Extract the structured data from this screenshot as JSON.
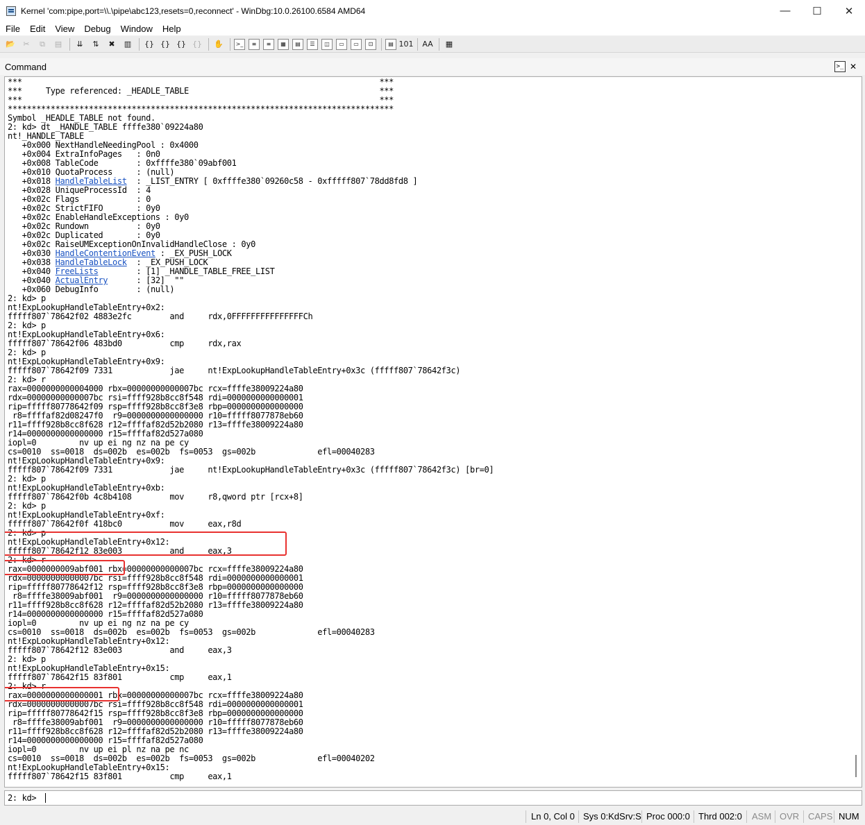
{
  "window": {
    "title": "Kernel 'com:pipe,port=\\\\.\\pipe\\abc123,resets=0,reconnect' - WinDbg:10.0.26100.6584 AMD64",
    "buttons": [
      "—",
      "☐",
      "✕"
    ]
  },
  "menu": [
    "File",
    "Edit",
    "View",
    "Debug",
    "Window",
    "Help"
  ],
  "toolbar_icons": [
    {
      "name": "open-icon",
      "glyph": "📂",
      "enabled": true
    },
    {
      "name": "cut-icon",
      "glyph": "✂",
      "enabled": false
    },
    {
      "name": "copy-icon",
      "glyph": "⧉",
      "enabled": false
    },
    {
      "name": "paste-icon",
      "glyph": "▤",
      "enabled": false
    },
    {
      "name": "sep"
    },
    {
      "name": "go-icon",
      "glyph": "⇊",
      "enabled": true
    },
    {
      "name": "restart-icon",
      "glyph": "⇅",
      "enabled": true
    },
    {
      "name": "stop-debugging-icon",
      "glyph": "✖",
      "enabled": true
    },
    {
      "name": "break-icon",
      "glyph": "▥",
      "enabled": true
    },
    {
      "name": "sep"
    },
    {
      "name": "step-into-icon",
      "glyph": "{}",
      "enabled": true
    },
    {
      "name": "step-over-icon",
      "glyph": "{}",
      "enabled": true
    },
    {
      "name": "step-out-icon",
      "glyph": "{}",
      "enabled": true
    },
    {
      "name": "run-to-cursor-icon",
      "glyph": "{}",
      "enabled": false
    },
    {
      "name": "sep"
    },
    {
      "name": "hand-icon",
      "glyph": "✋",
      "enabled": true
    },
    {
      "name": "sep"
    },
    {
      "name": "command-window-icon",
      "glyph": ">_",
      "enabled": true,
      "boxed": true
    },
    {
      "name": "watch-window-icon",
      "glyph": "≡",
      "enabled": true,
      "boxed": true
    },
    {
      "name": "locals-window-icon",
      "glyph": "≡",
      "enabled": true,
      "boxed": true
    },
    {
      "name": "registers-window-icon",
      "glyph": "▦",
      "enabled": true,
      "boxed": true
    },
    {
      "name": "memory-window-icon",
      "glyph": "▤",
      "enabled": true,
      "boxed": true
    },
    {
      "name": "call-stack-window-icon",
      "glyph": "☰",
      "enabled": true,
      "boxed": true
    },
    {
      "name": "disassembly-window-icon",
      "glyph": "◫",
      "enabled": true,
      "boxed": true
    },
    {
      "name": "scratch-pad-icon",
      "glyph": "▭",
      "enabled": true,
      "boxed": true
    },
    {
      "name": "processes-threads-icon",
      "glyph": "▭",
      "enabled": true,
      "boxed": true
    },
    {
      "name": "source-mode-icon",
      "glyph": "⊡",
      "enabled": true,
      "boxed": true
    },
    {
      "name": "sep"
    },
    {
      "name": "source-mode-on-icon",
      "glyph": "▤",
      "enabled": true,
      "boxed": true
    },
    {
      "name": "hex-display-icon",
      "glyph": "101",
      "enabled": true
    },
    {
      "name": "sep"
    },
    {
      "name": "font-icon",
      "glyph": "AA",
      "enabled": true
    },
    {
      "name": "sep"
    },
    {
      "name": "options-icon",
      "glyph": "▦",
      "enabled": true
    }
  ],
  "command_window": {
    "title": "Command",
    "output": [
      [
        {
          "t": "***                                                                           ***"
        }
      ],
      [
        {
          "t": "***     Type referenced: _HEADLE_TABLE                                        ***"
        }
      ],
      [
        {
          "t": "***                                                                           ***"
        }
      ],
      [
        {
          "t": "*********************************************************************************"
        }
      ],
      [
        {
          "t": "Symbol _HEADLE_TABLE not found."
        }
      ],
      [
        {
          "t": "2: kd> dt _HANDLE_TABLE ffffe380`09224a80"
        }
      ],
      [
        {
          "t": "nt!_HANDLE_TABLE"
        }
      ],
      [
        {
          "t": "   +0x000 NextHandleNeedingPool : 0x4000"
        }
      ],
      [
        {
          "t": "   +0x004 ExtraInfoPages   : 0n0"
        }
      ],
      [
        {
          "t": "   +0x008 TableCode        : 0xffffe380`09abf001"
        }
      ],
      [
        {
          "t": "   +0x010 QuotaProcess     : (null)"
        }
      ],
      [
        {
          "t": "   +0x018 "
        },
        {
          "t": "HandleTableList",
          "link": true
        },
        {
          "t": "  : _LIST_ENTRY [ 0xffffe380`09260c58 - 0xfffff807`78dd8fd8 ]"
        }
      ],
      [
        {
          "t": "   +0x028 UniqueProcessId  : 4"
        }
      ],
      [
        {
          "t": "   +0x02c Flags            : 0"
        }
      ],
      [
        {
          "t": "   +0x02c StrictFIFO       : 0y0"
        }
      ],
      [
        {
          "t": "   +0x02c EnableHandleExceptions : 0y0"
        }
      ],
      [
        {
          "t": "   +0x02c Rundown          : 0y0"
        }
      ],
      [
        {
          "t": "   +0x02c Duplicated       : 0y0"
        }
      ],
      [
        {
          "t": "   +0x02c RaiseUMExceptionOnInvalidHandleClose : 0y0"
        }
      ],
      [
        {
          "t": "   +0x030 "
        },
        {
          "t": "HandleContentionEvent",
          "link": true
        },
        {
          "t": " : _EX_PUSH_LOCK"
        }
      ],
      [
        {
          "t": "   +0x038 "
        },
        {
          "t": "HandleTableLock",
          "link": true
        },
        {
          "t": "  : _EX_PUSH_LOCK"
        }
      ],
      [
        {
          "t": "   +0x040 "
        },
        {
          "t": "FreeLists",
          "link": true
        },
        {
          "t": "        : [1] _HANDLE_TABLE_FREE_LIST"
        }
      ],
      [
        {
          "t": "   +0x040 "
        },
        {
          "t": "ActualEntry",
          "link": true
        },
        {
          "t": "      : [32]  \"\""
        }
      ],
      [
        {
          "t": "   +0x060 DebugInfo        : (null)"
        }
      ],
      [
        {
          "t": "2: kd> p"
        }
      ],
      [
        {
          "t": "nt!ExpLookupHandleTableEntry+0x2:"
        }
      ],
      [
        {
          "t": "fffff807`78642f02 4883e2fc        and     rdx,0FFFFFFFFFFFFFFFCh"
        }
      ],
      [
        {
          "t": "2: kd> p"
        }
      ],
      [
        {
          "t": "nt!ExpLookupHandleTableEntry+0x6:"
        }
      ],
      [
        {
          "t": "fffff807`78642f06 483bd0          cmp     rdx,rax"
        }
      ],
      [
        {
          "t": "2: kd> p"
        }
      ],
      [
        {
          "t": "nt!ExpLookupHandleTableEntry+0x9:"
        }
      ],
      [
        {
          "t": "fffff807`78642f09 7331            jae     nt!ExpLookupHandleTableEntry+0x3c (fffff807`78642f3c)"
        }
      ],
      [
        {
          "t": "2: kd> r"
        }
      ],
      [
        {
          "t": "rax=0000000000004000 rbx=00000000000007bc rcx=ffffe38009224a80"
        }
      ],
      [
        {
          "t": "rdx=00000000000007bc rsi=ffff928b8cc8f548 rdi=0000000000000001"
        }
      ],
      [
        {
          "t": "rip=fffff80778642f09 rsp=ffff928b8cc8f3e8 rbp=0000000000000000"
        }
      ],
      [
        {
          "t": " r8=ffffaf82d08247f0  r9=0000000000000000 r10=fffff8077878eb60"
        }
      ],
      [
        {
          "t": "r11=ffff928b8cc8f628 r12=ffffaf82d52b2080 r13=ffffe38009224a80"
        }
      ],
      [
        {
          "t": "r14=0000000000000000 r15=ffffaf82d527a080"
        }
      ],
      [
        {
          "t": "iopl=0         nv up ei ng nz na pe cy"
        }
      ],
      [
        {
          "t": "cs=0010  ss=0018  ds=002b  es=002b  fs=0053  gs=002b             efl=00040283"
        }
      ],
      [
        {
          "t": "nt!ExpLookupHandleTableEntry+0x9:"
        }
      ],
      [
        {
          "t": "fffff807`78642f09 7331            jae     nt!ExpLookupHandleTableEntry+0x3c (fffff807`78642f3c) [br=0]"
        }
      ],
      [
        {
          "t": "2: kd> p"
        }
      ],
      [
        {
          "t": "nt!ExpLookupHandleTableEntry+0xb:"
        }
      ],
      [
        {
          "t": "fffff807`78642f0b 4c8b4108        mov     r8,qword ptr [rcx+8]"
        }
      ],
      [
        {
          "t": "2: kd> p"
        }
      ],
      [
        {
          "t": "nt!ExpLookupHandleTableEntry+0xf:"
        }
      ],
      [
        {
          "t": "fffff807`78642f0f 418bc0          mov     eax,r8d"
        }
      ],
      [
        {
          "t": "2: kd> p"
        }
      ],
      [
        {
          "t": "nt!ExpLookupHandleTableEntry+0x12:"
        }
      ],
      [
        {
          "t": "fffff807`78642f12 83e003          and     eax,3"
        }
      ],
      [
        {
          "t": "2: kd> r"
        }
      ],
      [
        {
          "t": "rax=0000000009abf001 rbx=00000000000007bc rcx=ffffe38009224a80"
        }
      ],
      [
        {
          "t": "rdx=00000000000007bc rsi=ffff928b8cc8f548 rdi=0000000000000001"
        }
      ],
      [
        {
          "t": "rip=fffff80778642f12 rsp=ffff928b8cc8f3e8 rbp=0000000000000000"
        }
      ],
      [
        {
          "t": " r8=ffffe38009abf001  r9=0000000000000000 r10=fffff8077878eb60"
        }
      ],
      [
        {
          "t": "r11=ffff928b8cc8f628 r12=ffffaf82d52b2080 r13=ffffe38009224a80"
        }
      ],
      [
        {
          "t": "r14=0000000000000000 r15=ffffaf82d527a080"
        }
      ],
      [
        {
          "t": "iopl=0         nv up ei ng nz na pe cy"
        }
      ],
      [
        {
          "t": "cs=0010  ss=0018  ds=002b  es=002b  fs=0053  gs=002b             efl=00040283"
        }
      ],
      [
        {
          "t": "nt!ExpLookupHandleTableEntry+0x12:"
        }
      ],
      [
        {
          "t": "fffff807`78642f12 83e003          and     eax,3"
        }
      ],
      [
        {
          "t": "2: kd> p"
        }
      ],
      [
        {
          "t": "nt!ExpLookupHandleTableEntry+0x15:"
        }
      ],
      [
        {
          "t": "fffff807`78642f15 83f801          cmp     eax,1"
        }
      ],
      [
        {
          "t": "2: kd> r"
        }
      ],
      [
        {
          "t": "rax=0000000000000001 rbx=00000000000007bc rcx=ffffe38009224a80"
        }
      ],
      [
        {
          "t": "rdx=00000000000007bc rsi=ffff928b8cc8f548 rdi=0000000000000001"
        }
      ],
      [
        {
          "t": "rip=fffff80778642f15 rsp=ffff928b8cc8f3e8 rbp=0000000000000000"
        }
      ],
      [
        {
          "t": " r8=ffffe38009abf001  r9=0000000000000000 r10=fffff8077878eb60"
        }
      ],
      [
        {
          "t": "r11=ffff928b8cc8f628 r12=ffffaf82d52b2080 r13=ffffe38009224a80"
        }
      ],
      [
        {
          "t": "r14=0000000000000000 r15=ffffaf82d527a080"
        }
      ],
      [
        {
          "t": "iopl=0         nv up ei pl nz na pe nc"
        }
      ],
      [
        {
          "t": "cs=0010  ss=0018  ds=002b  es=002b  fs=0053  gs=002b             efl=00040202"
        }
      ],
      [
        {
          "t": "nt!ExpLookupHandleTableEntry+0x15:"
        }
      ],
      [
        {
          "t": "fffff807`78642f15 83f801          cmp     eax,1"
        }
      ]
    ],
    "prompt": "2: kd>",
    "input_value": ""
  },
  "status_bar": {
    "position": "Ln 0, Col 0",
    "sys": "Sys 0:KdSrv:S",
    "proc": "Proc 000:0",
    "thrd": "Thrd 002:0",
    "asm": "ASM",
    "ovr": "OVR",
    "caps": "CAPS",
    "num": "NUM"
  },
  "colors": {
    "link": "#1a53c2",
    "highlight_box": "#e8312f"
  }
}
